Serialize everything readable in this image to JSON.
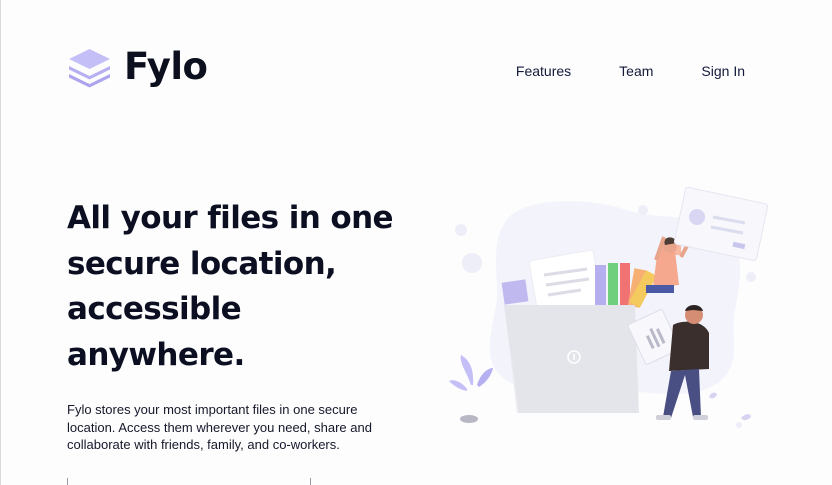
{
  "brand": {
    "name": "Fylo",
    "accent": "#bdb8f4"
  },
  "nav": {
    "items": [
      {
        "label": "Features"
      },
      {
        "label": "Team"
      },
      {
        "label": "Sign In"
      }
    ]
  },
  "hero": {
    "title": "All your files in one secure location, accessible anywhere.",
    "description": "Fylo stores your most important files in one secure location. Access them wherever you need, share and collaborate with friends, family, and co-workers."
  },
  "illustration": {
    "name": "people-organizing-files-illustration"
  }
}
